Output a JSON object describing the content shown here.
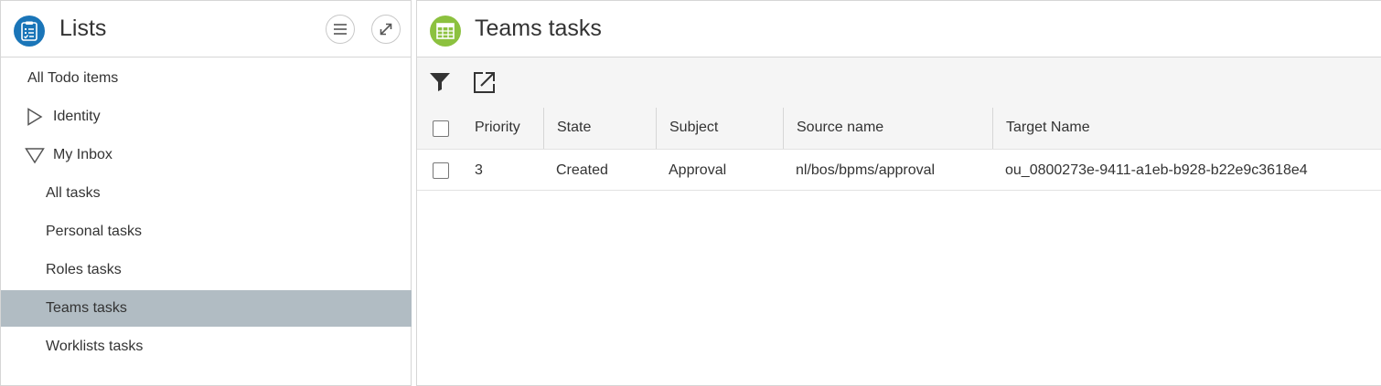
{
  "left_panel": {
    "title": "Lists",
    "icons": {
      "app": "clipboard-list-icon",
      "menu": "hamburger-menu-icon",
      "expand": "expand-arrow-icon"
    },
    "nav": [
      {
        "label": "All Todo items",
        "level": 0
      },
      {
        "label": "Identity",
        "level": 0,
        "toggle": "collapsed"
      },
      {
        "label": "My Inbox",
        "level": 0,
        "toggle": "expanded"
      },
      {
        "label": "All tasks",
        "level": 1
      },
      {
        "label": "Personal tasks",
        "level": 1
      },
      {
        "label": "Roles tasks",
        "level": 1
      },
      {
        "label": "Teams tasks",
        "level": 1,
        "selected": true
      },
      {
        "label": "Worklists tasks",
        "level": 1
      }
    ],
    "colors": {
      "app_icon": "#1a75b8",
      "selected_bg": "#b1bcc3"
    }
  },
  "right_panel": {
    "title": "Teams tasks",
    "icons": {
      "app": "table-grid-icon",
      "filter": "filter-icon",
      "export": "export-icon"
    },
    "colors": {
      "app_icon": "#8cc13f"
    },
    "table": {
      "columns": [
        "Priority",
        "State",
        "Subject",
        "Source name",
        "Target Name"
      ],
      "rows": [
        {
          "priority": "3",
          "state": "Created",
          "subject": "Approval",
          "source_name": "nl/bos/bpms/approval",
          "target_name": "ou_0800273e-9411-a1eb-b928-b22e9c3618e4"
        }
      ]
    }
  }
}
